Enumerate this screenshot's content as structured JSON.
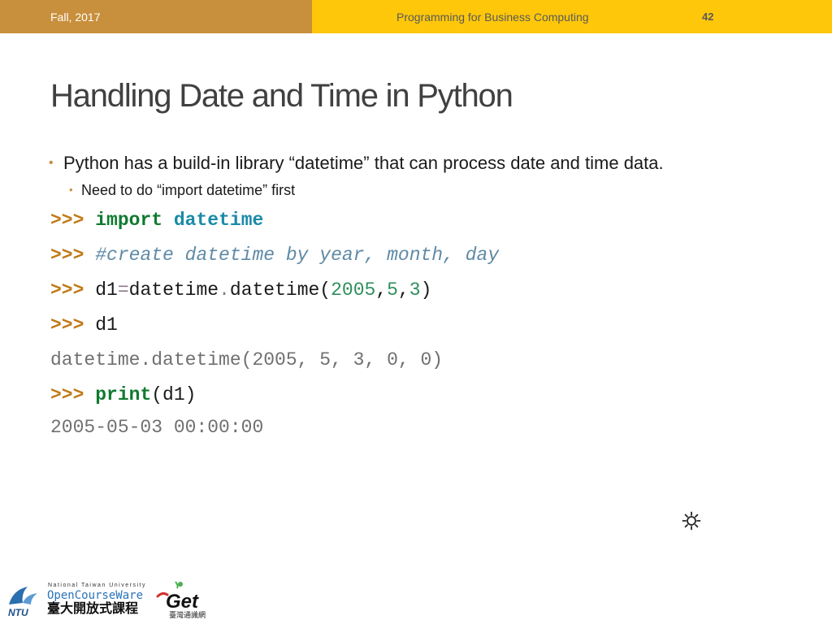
{
  "header": {
    "term": "Fall, 2017",
    "course": "Programming for Business Computing",
    "page_number": "42"
  },
  "slide": {
    "title": "Handling Date and Time in Python",
    "bullets": [
      "Python has a build-in library “datetime” that can process date and time data.",
      "Need to do “import datetime” first"
    ],
    "code": {
      "prompt": ">>>",
      "line1": {
        "keyword": "import",
        "module": "datetime"
      },
      "line2": {
        "comment": "#create datetime by year, month, day"
      },
      "line3": {
        "var": "d1",
        "eq": "=",
        "obj": "datetime",
        "dot": ".",
        "call": "datetime(",
        "year": "2005",
        "c1": ",",
        "month": "5",
        "c2": ",",
        "day": "3",
        "close": ")"
      },
      "line4": {
        "expr": "d1"
      },
      "output1": "datetime.datetime(2005, 5, 3, 0, 0)",
      "line5": {
        "func": "print",
        "args": "(d1)"
      },
      "output2": "2005-05-03 00:00:00"
    }
  },
  "footer": {
    "ntu_logo_text": "NTU",
    "university": "National Taiwan University",
    "ocw": "OpenCourseWare",
    "ocw_chinese": "臺大開放式課程",
    "get_logo_text": "Get",
    "get_chinese": "臺灣通識網"
  },
  "colors": {
    "header_left": "#c88f3c",
    "header_right": "#fec70a",
    "prompt": "#c07a16",
    "keyword": "#0f7a2e",
    "module": "#1a8aa8",
    "comment": "#5f8aa5"
  },
  "icons": [
    "sun-icon",
    "ntu-logo-icon",
    "get-logo-icon"
  ]
}
